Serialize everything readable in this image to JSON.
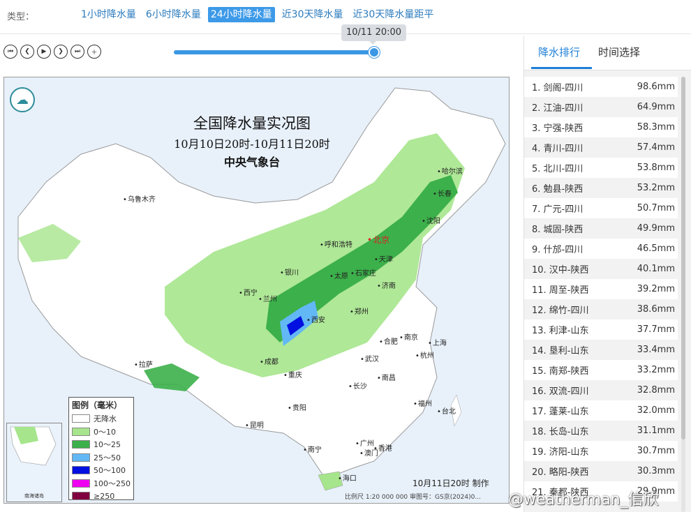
{
  "top": {
    "type_label": "类型：",
    "tabs": [
      {
        "label": "1小时降水量"
      },
      {
        "label": "6小时降水量"
      },
      {
        "label": "24小时降水量",
        "active": true
      },
      {
        "label": "近30天降水量"
      },
      {
        "label": "近30天降水量距平"
      }
    ]
  },
  "player": {
    "buttons": [
      "first-icon",
      "prev-icon",
      "play-icon",
      "next-icon",
      "last-icon",
      "zoom-in-icon"
    ],
    "time_tooltip": "10/11 20:00",
    "progress": 1.0
  },
  "map": {
    "title": "全国降水量实况图",
    "subtitle": "10月10日20时-10月11日20时",
    "org": "中央气象台",
    "cities": [
      "乌鲁木齐",
      "哈尔滨",
      "长春",
      "沈阳",
      "呼和浩特",
      "北京",
      "天津",
      "石家庄",
      "太原",
      "银川",
      "济南",
      "西宁",
      "兰州",
      "郑州",
      "西安",
      "合肥",
      "南京",
      "上海",
      "成都",
      "武汉",
      "杭州",
      "拉萨",
      "重庆",
      "南昌",
      "长沙",
      "福州",
      "台北",
      "贵阳",
      "昆明",
      "南宁",
      "广州",
      "澳门",
      "香港",
      "海口"
    ],
    "legend_title": "图例（毫米）",
    "legend": [
      {
        "label": "无降水",
        "color": "#ffffff"
      },
      {
        "label": "0～10",
        "color": "#a6e58c"
      },
      {
        "label": "10～25",
        "color": "#3cb04a"
      },
      {
        "label": "25～50",
        "color": "#62b8f5"
      },
      {
        "label": "50～100",
        "color": "#0010e0"
      },
      {
        "label": "100～250",
        "color": "#f000f0"
      },
      {
        "label": "≥250",
        "color": "#800040"
      }
    ],
    "inset_label": "南海诸岛",
    "made_text": "10月11日20时 制作",
    "scale_text": "比例尺 1:20 000 000    审图号：GS京(2024)0...",
    "colors": {
      "land": "#ffffff",
      "sea": "#e8f1fa",
      "light": "#a6e58c",
      "mid": "#3cb04a",
      "heavy": "#62b8f5",
      "storm": "#0010e0"
    }
  },
  "sidebar": {
    "tabs": [
      {
        "label": "降水排行",
        "active": true
      },
      {
        "label": "时间选择"
      }
    ],
    "ranking": [
      {
        "name": "1. 剑阁-四川",
        "value": "98.6mm"
      },
      {
        "name": "2. 江油-四川",
        "value": "64.9mm"
      },
      {
        "name": "3. 宁强-陕西",
        "value": "58.3mm"
      },
      {
        "name": "4. 青川-四川",
        "value": "57.4mm"
      },
      {
        "name": "5. 北川-四川",
        "value": "53.8mm"
      },
      {
        "name": "6. 勉县-陕西",
        "value": "53.2mm"
      },
      {
        "name": "7. 广元-四川",
        "value": "50.7mm"
      },
      {
        "name": "8. 城固-陕西",
        "value": "49.9mm"
      },
      {
        "name": "9. 什邡-四川",
        "value": "46.5mm"
      },
      {
        "name": "10. 汉中-陕西",
        "value": "40.1mm"
      },
      {
        "name": "11. 周至-陕西",
        "value": "39.2mm"
      },
      {
        "name": "12. 绵竹-四川",
        "value": "38.6mm"
      },
      {
        "name": "13. 利津-山东",
        "value": "37.7mm"
      },
      {
        "name": "14. 垦利-山东",
        "value": "33.4mm"
      },
      {
        "name": "15. 南郑-陕西",
        "value": "33.2mm"
      },
      {
        "name": "16. 双流-四川",
        "value": "32.8mm"
      },
      {
        "name": "17. 蓬莱-山东",
        "value": "32.0mm"
      },
      {
        "name": "18. 长岛-山东",
        "value": "31.1mm"
      },
      {
        "name": "19. 济阳-山东",
        "value": "30.7mm"
      },
      {
        "name": "20. 略阳-陕西",
        "value": "30.3mm"
      },
      {
        "name": "21. 秦都-陕西",
        "value": "29.9mm"
      }
    ]
  },
  "watermark": "@weatherman_信欣"
}
